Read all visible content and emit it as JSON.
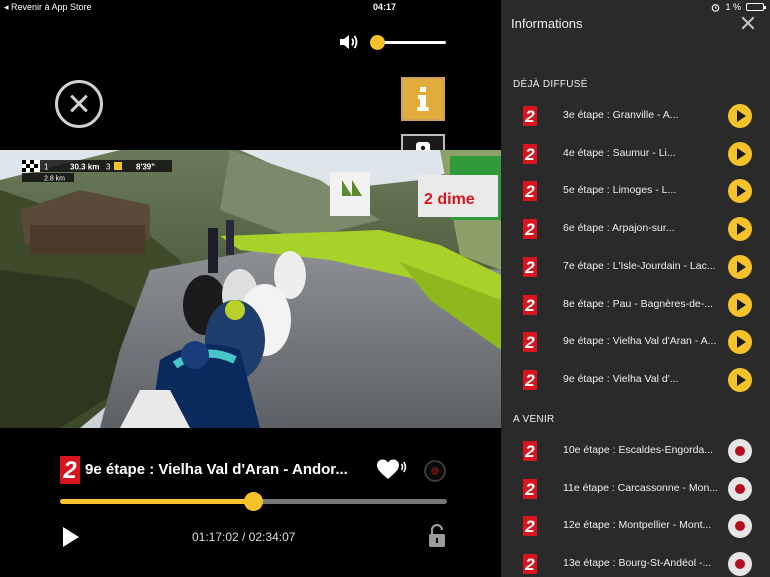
{
  "status_bar": {
    "back_label": "◂ Revenir à App Store",
    "time": "04:17",
    "battery": "1 %"
  },
  "player": {
    "volume_level": 0.0,
    "episode_title": "9e étape : Vielha Val d'Aran - Andor...",
    "timecode": "01:17:02 / 02:34:07",
    "progress": 0.5,
    "channel_logo": "2",
    "video_overlay": {
      "stage_num": "1",
      "distance": "30.3 km",
      "rank": "3",
      "gap": "8'39\"",
      "remaining": "2.8 km",
      "board_text": "2 dime"
    }
  },
  "panel": {
    "title": "Informations",
    "sections": [
      {
        "label": "DÉJÀ DIFFUSÉ",
        "items": [
          {
            "logo": "2",
            "title": "3e étape : Granville - A..."
          },
          {
            "logo": "2",
            "title": "4e étape : Saumur - Li..."
          },
          {
            "logo": "2",
            "title": "5e étape : Limoges - L..."
          },
          {
            "logo": "2",
            "title": "6e étape : Arpajon-sur..."
          },
          {
            "logo": "2",
            "title": "7e étape : L'Isle-Jourdain - Lac..."
          },
          {
            "logo": "2",
            "title": "8e étape : Pau - Bagnères-de-..."
          },
          {
            "logo": "2",
            "title": "9e étape : Vielha Val d'Aran - A..."
          },
          {
            "logo": "2",
            "title": "9e étape : Vielha Val d'..."
          }
        ]
      },
      {
        "label": "A VENIR",
        "items": [
          {
            "logo": "2",
            "title": "10e étape : Escaldes-Engorda..."
          },
          {
            "logo": "2",
            "title": "11e étape : Carcassonne - Mon..."
          },
          {
            "logo": "2",
            "title": "12e étape : Montpellier - Mont..."
          },
          {
            "logo": "2",
            "title": "13e étape : Bourg-St-Andéol -..."
          }
        ]
      }
    ]
  },
  "colors": {
    "accent": "#f5c22b",
    "panel_bg": "#2a2a2a",
    "channel_red": "#d8141e",
    "record_red": "#b40f1c"
  }
}
